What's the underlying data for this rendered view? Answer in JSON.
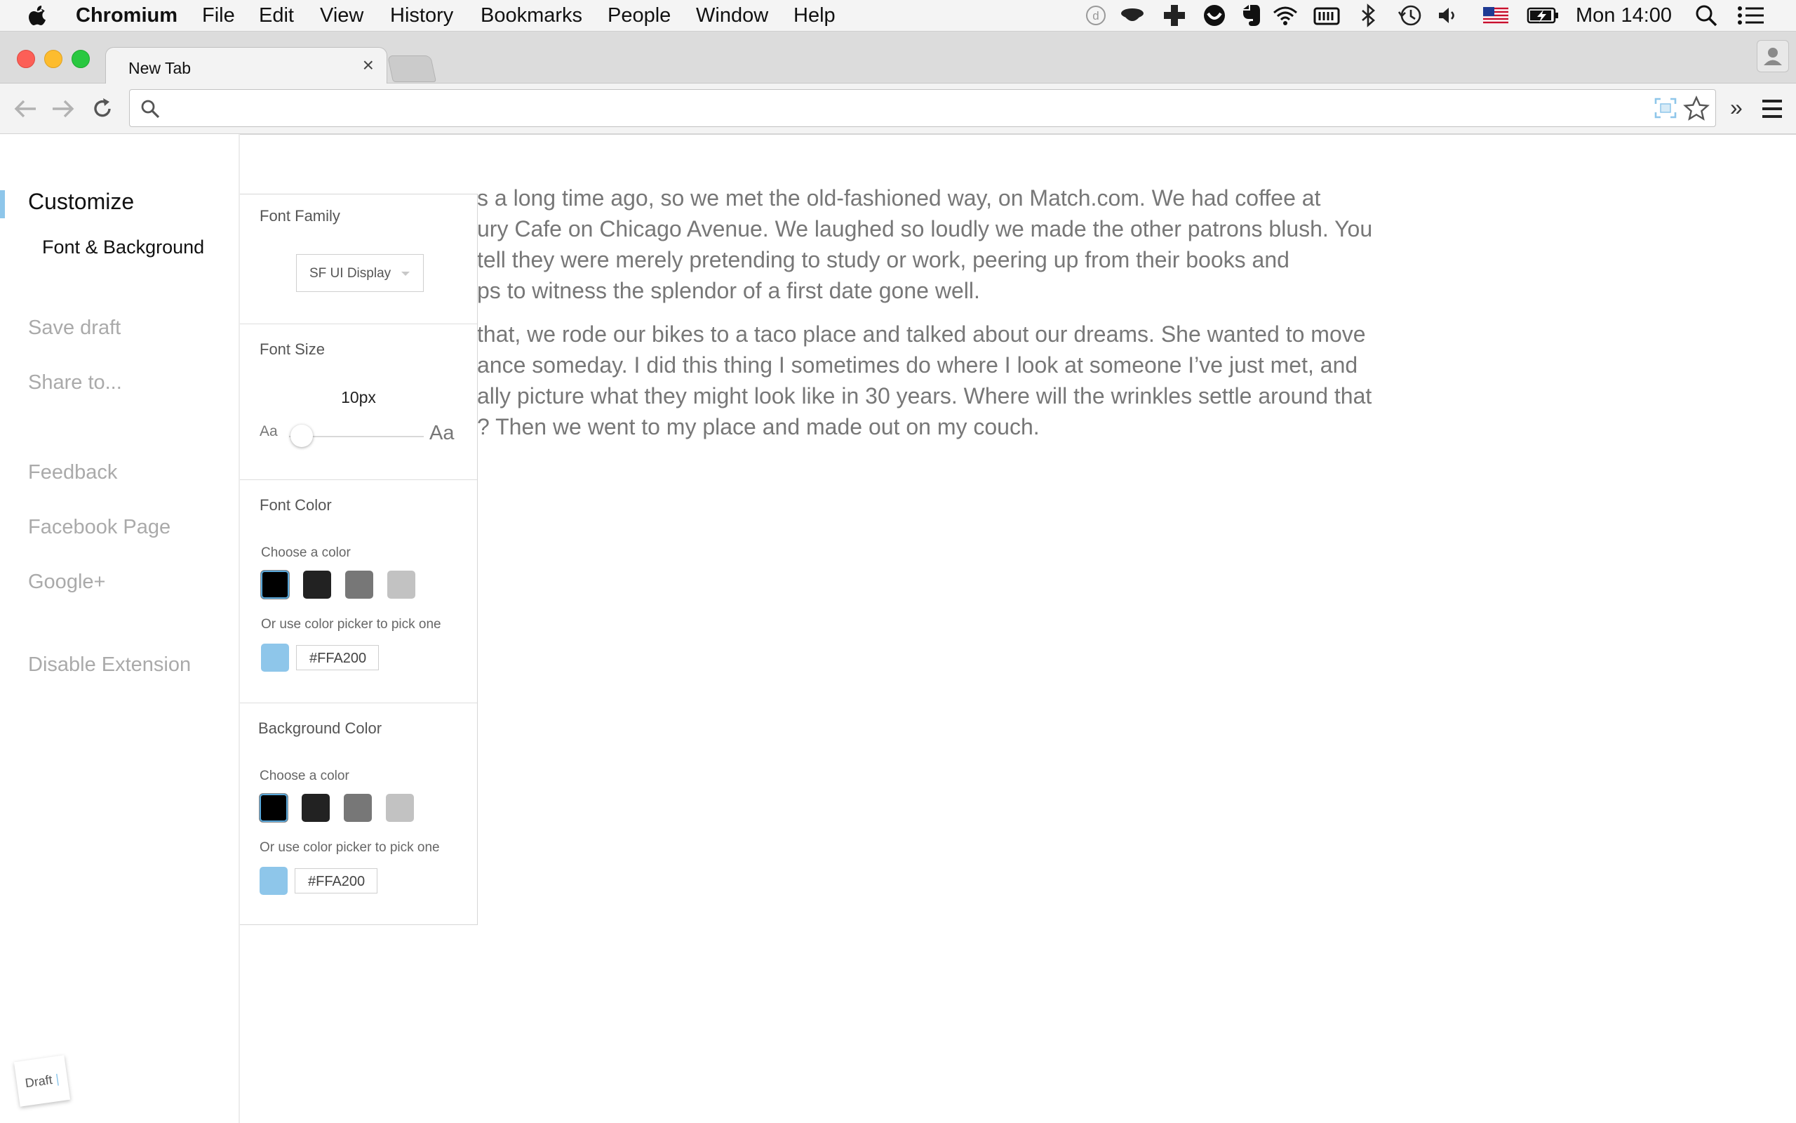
{
  "menubar": {
    "app_name": "Chromium",
    "items": [
      "File",
      "Edit",
      "View",
      "History",
      "Bookmarks",
      "People",
      "Window",
      "Help"
    ],
    "clock": "Mon 14:00"
  },
  "tab": {
    "title": "New Tab",
    "close_glyph": "×"
  },
  "toolbar": {
    "omnibox_value": "",
    "overflow_glyph": "»"
  },
  "sidebar": {
    "heading": "Customize",
    "subitem": "Font & Background",
    "actions": [
      "Save draft",
      "Share to..."
    ],
    "links": [
      "Feedback",
      "Facebook Page",
      "Google+"
    ],
    "disable": "Disable Extension",
    "draft_badge": "Draft"
  },
  "panel": {
    "font_family": {
      "title": "Font Family",
      "selected": "SF UI Display"
    },
    "font_size": {
      "title": "Font Size",
      "value": "10px",
      "min_label": "Aa",
      "max_label": "Aa",
      "level": 0.05
    },
    "font_color": {
      "title": "Font Color",
      "choose": "Choose a color",
      "picker_hint": "Or use color picker to pick one",
      "swatches": [
        "#000000",
        "#222222",
        "#777777",
        "#c2c2c2"
      ],
      "picked_color": "#8ec6ea",
      "hex": "#FFA200"
    },
    "background_color": {
      "title": "Background Color",
      "choose": "Choose a color",
      "picker_hint": "Or use color picker to pick one",
      "swatches": [
        "#000000",
        "#222222",
        "#777777",
        "#c2c2c2"
      ],
      "picked_color": "#8ec6ea",
      "hex": "#FFA200"
    }
  },
  "article": {
    "paragraphs": [
      [
        "s a long time ago, so we met the old-fashioned way, on Match.com. We had coffee at",
        "ury Cafe on Chicago Avenue. We laughed so loudly we made the other patrons blush. You",
        " tell they were merely pretending to study or work, peering up from their books and",
        "ps to witness the splendor of a first date gone well."
      ],
      [
        "that, we rode our bikes to a taco place and talked about our dreams. She wanted to move",
        "ance someday. I did this thing I sometimes do where I look at someone I’ve just met, and",
        "ally picture what they might look like in 30 years. Where will the wrinkles settle around that",
        "? Then we went to my place and made out on my couch."
      ]
    ]
  },
  "colors": {
    "accent": "#8ec6ea",
    "close_light": "#fc5f57",
    "minimize_light": "#fdbc2e",
    "zoom_light": "#29c840"
  }
}
